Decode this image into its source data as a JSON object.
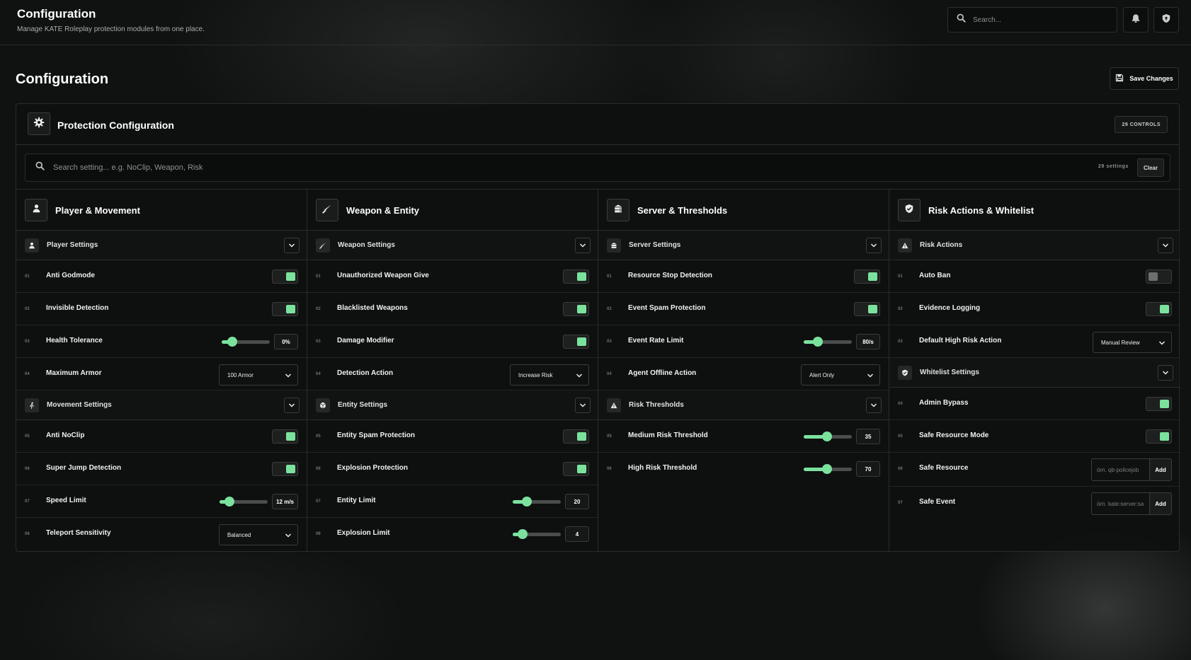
{
  "header": {
    "title": "Configuration",
    "subtitle": "Manage KATE Roleplay protection modules from one place.",
    "search_placeholder": "Search..."
  },
  "page": {
    "title": "Configuration",
    "save_label": "Save Changes"
  },
  "panel": {
    "title": "Protection Configuration",
    "controls_badge": "29 CONTROLS",
    "search_placeholder": "Search setting... e.g. NoClip, Weapon, Risk",
    "count_label": "29 settings",
    "clear_label": "Clear"
  },
  "accent": "#7be29e",
  "columns": [
    {
      "title": "Player & Movement",
      "sections": [
        {
          "title": "Player Settings",
          "rows": [
            {
              "num": "01",
              "label": "Anti Godmode"
            },
            {
              "num": "02",
              "label": "Invisible Detection"
            },
            {
              "num": "03",
              "label": "Health Tolerance",
              "value": "0%"
            },
            {
              "num": "04",
              "label": "Maximum Armor",
              "value": "100 Armor"
            }
          ]
        },
        {
          "title": "Movement Settings",
          "rows": [
            {
              "num": "05",
              "label": "Anti NoClip"
            },
            {
              "num": "06",
              "label": "Super Jump Detection"
            },
            {
              "num": "07",
              "label": "Speed Limit",
              "value": "12 m/s"
            },
            {
              "num": "08",
              "label": "Teleport Sensitivity",
              "value": "Balanced"
            }
          ]
        }
      ]
    },
    {
      "title": "Weapon & Entity",
      "sections": [
        {
          "title": "Weapon Settings",
          "rows": [
            {
              "num": "01",
              "label": "Unauthorized Weapon Give"
            },
            {
              "num": "02",
              "label": "Blacklisted Weapons"
            },
            {
              "num": "03",
              "label": "Damage Modifier"
            },
            {
              "num": "04",
              "label": "Detection Action",
              "value": "Increase Risk"
            }
          ]
        },
        {
          "title": "Entity Settings",
          "rows": [
            {
              "num": "05",
              "label": "Entity Spam Protection"
            },
            {
              "num": "06",
              "label": "Explosion Protection"
            },
            {
              "num": "07",
              "label": "Entity Limit",
              "value": "20"
            },
            {
              "num": "08",
              "label": "Explosion Limit",
              "value": "4"
            }
          ]
        }
      ]
    },
    {
      "title": "Server & Thresholds",
      "sections": [
        {
          "title": "Server Settings",
          "rows": [
            {
              "num": "01",
              "label": "Resource Stop Detection"
            },
            {
              "num": "02",
              "label": "Event Spam Protection"
            },
            {
              "num": "03",
              "label": "Event Rate Limit",
              "value": "80/s"
            },
            {
              "num": "04",
              "label": "Agent Offline Action",
              "value": "Alert Only"
            }
          ]
        },
        {
          "title": "Risk Thresholds",
          "rows": [
            {
              "num": "05",
              "label": "Medium Risk Threshold",
              "value": "35"
            },
            {
              "num": "06",
              "label": "High Risk Threshold",
              "value": "70"
            }
          ]
        }
      ]
    },
    {
      "title": "Risk Actions & Whitelist",
      "sections": [
        {
          "title": "Risk Actions",
          "rows": [
            {
              "num": "01",
              "label": "Auto Ban"
            },
            {
              "num": "02",
              "label": "Evidence Logging"
            },
            {
              "num": "03",
              "label": "Default High Risk Action",
              "value": "Manual Review"
            }
          ]
        },
        {
          "title": "Whitelist Settings",
          "rows": [
            {
              "num": "04",
              "label": "Admin Bypass"
            },
            {
              "num": "05",
              "label": "Safe Resource Mode"
            },
            {
              "num": "06",
              "label": "Safe Resource",
              "placeholder": "örn. qb-policejob",
              "add_label": "Add"
            },
            {
              "num": "07",
              "label": "Safe Event",
              "placeholder": "örn. kate:server:sa",
              "add_label": "Add"
            }
          ]
        }
      ]
    }
  ]
}
